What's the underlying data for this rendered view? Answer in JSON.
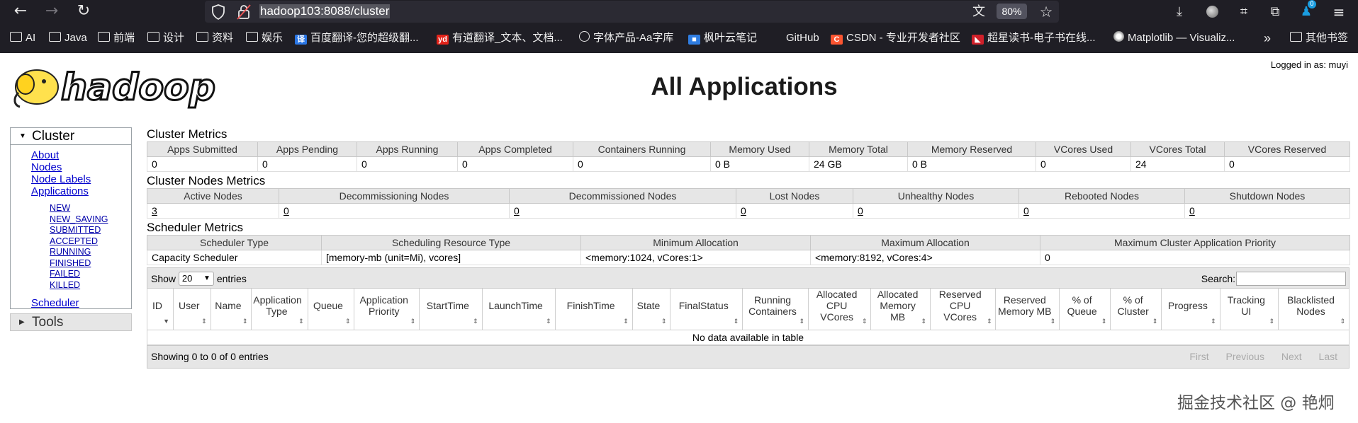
{
  "browser": {
    "url": "hadoop103:8088/cluster",
    "zoom": "80%",
    "badge_count": "0",
    "bookmarks": [
      {
        "label": "AI",
        "icon": "folder-icon"
      },
      {
        "label": "Java",
        "icon": "folder-icon"
      },
      {
        "label": "前端",
        "icon": "folder-icon"
      },
      {
        "label": "设计",
        "icon": "folder-icon"
      },
      {
        "label": "资料",
        "icon": "folder-icon"
      },
      {
        "label": "娱乐",
        "icon": "folder-icon"
      },
      {
        "label": "百度翻译-您的超级翻...",
        "icon": "baidu-translate-icon"
      },
      {
        "label": "有道翻译_文本、文档...",
        "icon": "youdao-icon"
      },
      {
        "label": "字体产品-Aa字库",
        "icon": "globe-icon"
      },
      {
        "label": "枫叶云笔记",
        "icon": "note-icon"
      },
      {
        "label": "GitHub",
        "icon": "github-icon"
      },
      {
        "label": "CSDN - 专业开发者社区",
        "icon": "csdn-icon"
      },
      {
        "label": "超星读书-电子书在线...",
        "icon": "chaoxing-icon"
      },
      {
        "label": "Matplotlib — Visualiz...",
        "icon": "matplotlib-icon"
      },
      {
        "label": "其他书签",
        "icon": "folder-icon"
      }
    ],
    "overflow_label": "»",
    "colors": {
      "chrome_bg": "#1f1e25",
      "urlbar_bg": "#2b2a33",
      "badge": "#1a9de0"
    }
  },
  "header": {
    "logo_text": "hadoop",
    "logged_in": "Logged in as: muyi",
    "title": "All Applications"
  },
  "sidebar": {
    "cluster_label": "Cluster",
    "links": [
      "About",
      "Nodes",
      "Node Labels",
      "Applications"
    ],
    "app_states": [
      "NEW",
      "NEW_SAVING",
      "SUBMITTED",
      "ACCEPTED",
      "RUNNING",
      "FINISHED",
      "FAILED",
      "KILLED"
    ],
    "scheduler_label": "Scheduler",
    "tools_label": "Tools"
  },
  "cluster_metrics": {
    "title": "Cluster Metrics",
    "headers": [
      "Apps Submitted",
      "Apps Pending",
      "Apps Running",
      "Apps Completed",
      "Containers Running",
      "Memory Used",
      "Memory Total",
      "Memory Reserved",
      "VCores Used",
      "VCores Total",
      "VCores Reserved"
    ],
    "values": [
      "0",
      "0",
      "0",
      "0",
      "0",
      "0 B",
      "24 GB",
      "0 B",
      "0",
      "24",
      "0"
    ]
  },
  "node_metrics": {
    "title": "Cluster Nodes Metrics",
    "headers": [
      "Active Nodes",
      "Decommissioning Nodes",
      "Decommissioned Nodes",
      "Lost Nodes",
      "Unhealthy Nodes",
      "Rebooted Nodes",
      "Shutdown Nodes"
    ],
    "values": [
      "3",
      "0",
      "0",
      "0",
      "0",
      "0",
      "0"
    ]
  },
  "scheduler_metrics": {
    "title": "Scheduler Metrics",
    "headers": [
      "Scheduler Type",
      "Scheduling Resource Type",
      "Minimum Allocation",
      "Maximum Allocation",
      "Maximum Cluster Application Priority"
    ],
    "values": [
      "Capacity Scheduler",
      "[memory-mb (unit=Mi), vcores]",
      "<memory:1024, vCores:1>",
      "<memory:8192, vCores:4>",
      "0"
    ]
  },
  "apps_table": {
    "show_label": "Show",
    "entries_value": "20",
    "entries_label": "entries",
    "search_label": "Search:",
    "columns": [
      "ID",
      "User",
      "Name",
      "Application Type",
      "Queue",
      "Application Priority",
      "StartTime",
      "LaunchTime",
      "FinishTime",
      "State",
      "FinalStatus",
      "Running Containers",
      "Allocated CPU VCores",
      "Allocated Memory MB",
      "Reserved CPU VCores",
      "Reserved Memory MB",
      "% of Queue",
      "% of Cluster",
      "Progress",
      "Tracking UI",
      "Blacklisted Nodes"
    ],
    "empty_text": "No data available in table",
    "info_text": "Showing 0 to 0 of 0 entries",
    "pager": [
      "First",
      "Previous",
      "Next",
      "Last"
    ]
  },
  "watermark": "掘金技术社区 @ 艳炯"
}
